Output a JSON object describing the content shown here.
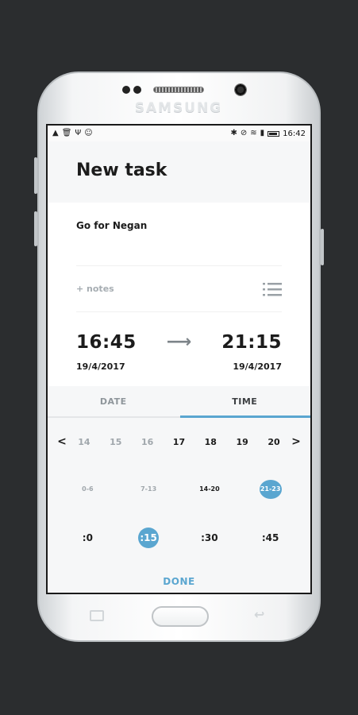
{
  "device": {
    "brand": "SAMSUNG"
  },
  "statusbar": {
    "time": "16:42",
    "left_icons": [
      "warning-icon",
      "trash-icon",
      "usb-icon",
      "smiley-icon"
    ],
    "right_icons": [
      "bluetooth-icon",
      "mute-icon",
      "wifi-icon",
      "signal-icon",
      "battery-icon"
    ]
  },
  "header": {
    "title": "New task"
  },
  "task": {
    "title": "Go for Negan",
    "notes_label": "+ notes"
  },
  "schedule": {
    "start_time": "16:45",
    "start_date": "19/4/2017",
    "end_time": "21:15",
    "end_date": "19/4/2017"
  },
  "tabs": [
    {
      "label": "DATE",
      "active": false
    },
    {
      "label": "TIME",
      "active": true
    }
  ],
  "picker": {
    "days": [
      "14",
      "15",
      "16",
      "17",
      "18",
      "19",
      "20"
    ],
    "hour_ranges": [
      "0-6",
      "7-13",
      "14-20",
      "21-23"
    ],
    "minutes": [
      ":0",
      ":15",
      ":30",
      ":45"
    ]
  },
  "done_label": "DONE",
  "colors": {
    "accent": "#5aa6d0",
    "text": "#1c1c1c",
    "muted": "#a0a7ac"
  }
}
